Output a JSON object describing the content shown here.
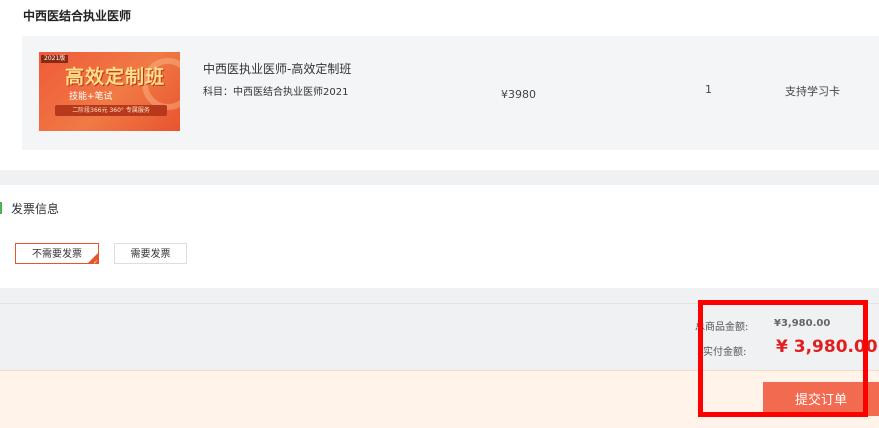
{
  "product_section": {
    "category_title": "中西医结合执业医师",
    "item": {
      "thumbnail": {
        "year_badge": "2021版",
        "main_text": "高效定制班",
        "sub_text": "技能+笔试",
        "band_text": "二阶段366元 360° 专属服务"
      },
      "name": "中西医执业医师-高效定制班",
      "subject": "科目：中西医结合执业医师2021",
      "price": "¥3980",
      "quantity": "1",
      "support": "支持学习卡"
    }
  },
  "invoice": {
    "title": "发票信息",
    "options": [
      {
        "label": "不需要发票",
        "selected": true
      },
      {
        "label": "需要发票",
        "selected": false
      }
    ]
  },
  "summary": {
    "total_label": "总商品金额:",
    "total_value": "¥3,980.00",
    "paid_label": "实付金额:",
    "paid_value": "¥ 3,980.00"
  },
  "submit_label": "提交订单",
  "colors": {
    "accent": "#e4572e",
    "price_red": "#e02020",
    "submit_bg": "#f26a4f",
    "highlight": "#ff0000"
  }
}
